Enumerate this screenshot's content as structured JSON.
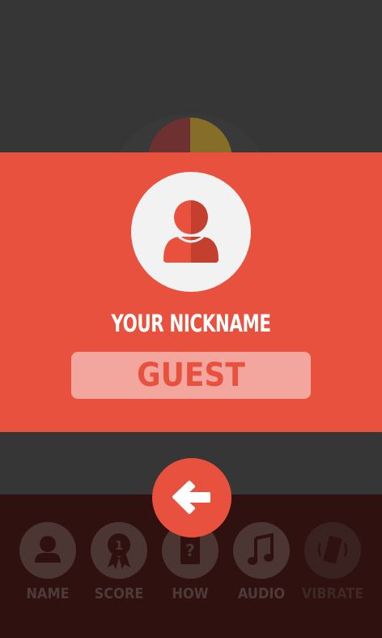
{
  "dialog": {
    "title": "YOUR NICKNAME",
    "nickname_value": "GUEST",
    "avatar_icon": "user-avatar-icon"
  },
  "back_button": {
    "icon": "arrow-left-icon"
  },
  "menu": {
    "items": [
      {
        "label": "NAME",
        "icon": "user-icon"
      },
      {
        "label": "SCORE",
        "icon": "ribbon-medal-icon"
      },
      {
        "label": "HOW",
        "icon": "question-card-icon"
      },
      {
        "label": "AUDIO",
        "icon": "music-note-icon"
      },
      {
        "label": "VIBRATE",
        "icon": "vibrate-phone-icon"
      }
    ]
  },
  "colors": {
    "accent": "#e8513d",
    "background": "#363636",
    "panel": "#2f110f",
    "input_background": "#f3a69d"
  }
}
